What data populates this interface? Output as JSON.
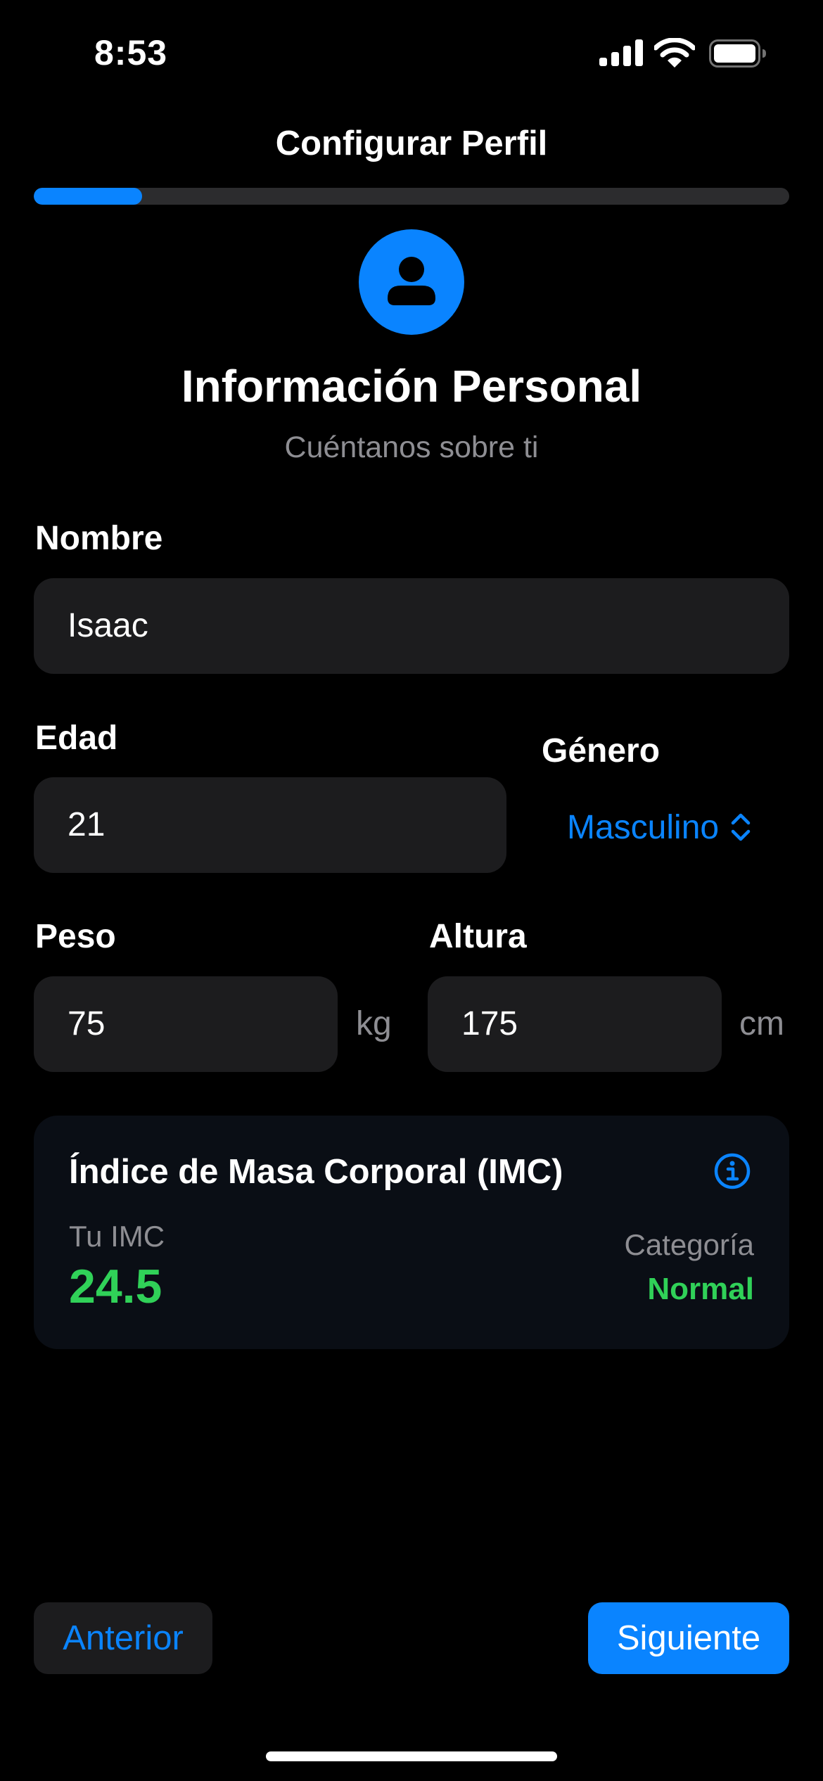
{
  "status_bar": {
    "time": "8:53"
  },
  "header": {
    "title": "Configurar Perfil",
    "progress_fraction": 0.143
  },
  "section": {
    "icon": "person-circle-icon",
    "title": "Información Personal",
    "subtitle": "Cuéntanos sobre ti"
  },
  "form": {
    "name": {
      "label": "Nombre",
      "value": "Isaac"
    },
    "age": {
      "label": "Edad",
      "value": "21"
    },
    "gender": {
      "label": "Género",
      "selected": "Masculino"
    },
    "weight": {
      "label": "Peso",
      "value": "75",
      "unit": "kg"
    },
    "height": {
      "label": "Altura",
      "value": "175",
      "unit": "cm"
    }
  },
  "bmi": {
    "title": "Índice de Masa Corporal (IMC)",
    "your_label": "Tu IMC",
    "value": "24.5",
    "category_label": "Categoría",
    "category_value": "Normal"
  },
  "footer": {
    "prev_label": "Anterior",
    "next_label": "Siguiente"
  },
  "colors": {
    "accent": "#0a84ff",
    "success": "#30d158",
    "field_bg": "#1c1c1e",
    "secondary_text": "#8e8e93"
  }
}
